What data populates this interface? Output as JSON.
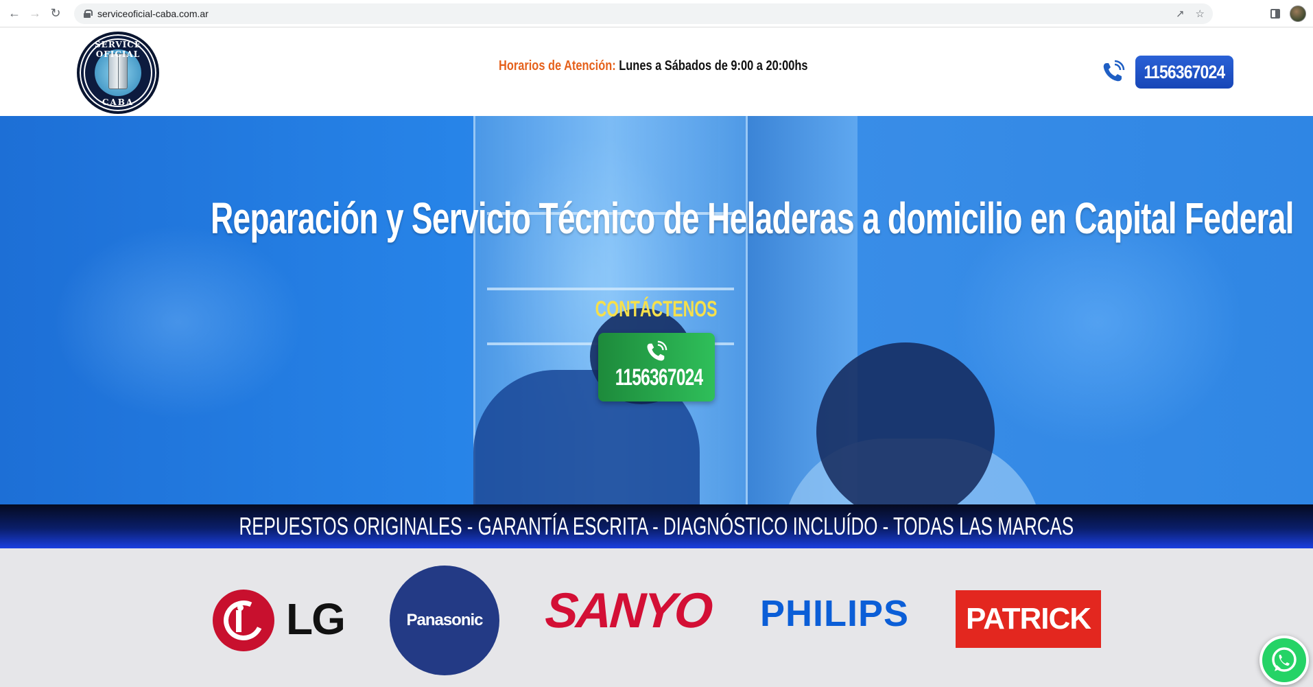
{
  "browser": {
    "url": "serviceoficial-caba.com.ar"
  },
  "header": {
    "logo_top": "SERVICE OFICIAL",
    "logo_bottom": "CABA",
    "hours_label": "Horarios de Atención:",
    "hours_value": "Lunes a Sábados de 9:00 a 20:00hs",
    "phone": "1156367024"
  },
  "hero": {
    "title": "Reparación y Servicio Técnico de Heladeras a domicilio en Capital Federal",
    "contact_label": "CONTÁCTENOS",
    "contact_phone": "1156367024"
  },
  "banner": {
    "text": "REPUESTOS ORIGINALES - GARANTÍA ESCRITA - DIAGNÓSTICO INCLUÍDO - TODAS LAS MARCAS"
  },
  "brands": {
    "lg": "LG",
    "panasonic": "Panasonic",
    "sanyo": "SANYO",
    "philips": "PHILIPS",
    "patrick": "PATRICK"
  },
  "colors": {
    "hours_label": "#e5611c",
    "phone_button": "#1f54c8",
    "contact_button": "#27a84b",
    "contact_label": "#f6e04c",
    "lg": "#c8102e",
    "panasonic": "#233a85",
    "sanyo": "#d30f35",
    "philips": "#0b5ed7",
    "patrick": "#e3271f",
    "whatsapp": "#25d366"
  },
  "icons": {
    "back": "arrow-left-icon",
    "forward": "arrow-right-icon",
    "reload": "reload-icon",
    "share": "share-icon",
    "bookmark": "star-icon",
    "sidepanel": "side-panel-icon",
    "phone": "phone-ringing-icon",
    "whatsapp": "whatsapp-icon"
  }
}
